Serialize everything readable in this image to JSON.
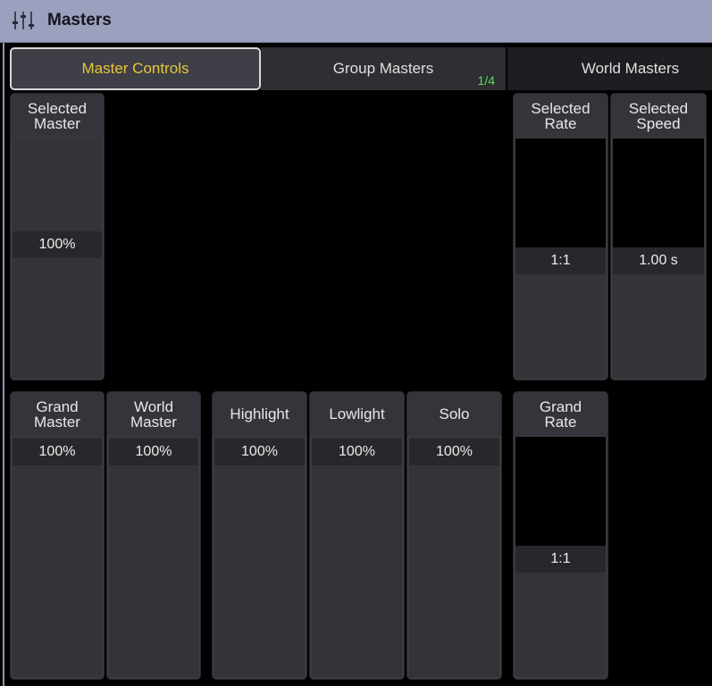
{
  "window": {
    "title": "Masters",
    "icon": "sliders-icon"
  },
  "tabs": [
    {
      "label": "Master Controls",
      "active": true
    },
    {
      "label": "Group Masters",
      "page": "1/4"
    },
    {
      "label": "World Masters"
    }
  ],
  "faders": {
    "selected_master": {
      "label": "Selected\nMaster",
      "value": "100%"
    },
    "selected_rate": {
      "label": "Selected\nRate",
      "value": "1:1"
    },
    "selected_speed": {
      "label": "Selected\nSpeed",
      "value": "1.00 s"
    },
    "grand_master": {
      "label": "Grand\nMaster",
      "value": "100%"
    },
    "world_master": {
      "label": "World\nMaster",
      "value": "100%"
    },
    "highlight": {
      "label": "Highlight",
      "value": "100%"
    },
    "lowlight": {
      "label": "Lowlight",
      "value": "100%"
    },
    "solo": {
      "label": "Solo",
      "value": "100%"
    },
    "grand_rate": {
      "label": "Grand\nRate",
      "value": "1:1"
    }
  },
  "colors": {
    "accent": "#e8c63a",
    "page_indicator": "#5bd65b",
    "titlebar": "#9aa0bd"
  }
}
